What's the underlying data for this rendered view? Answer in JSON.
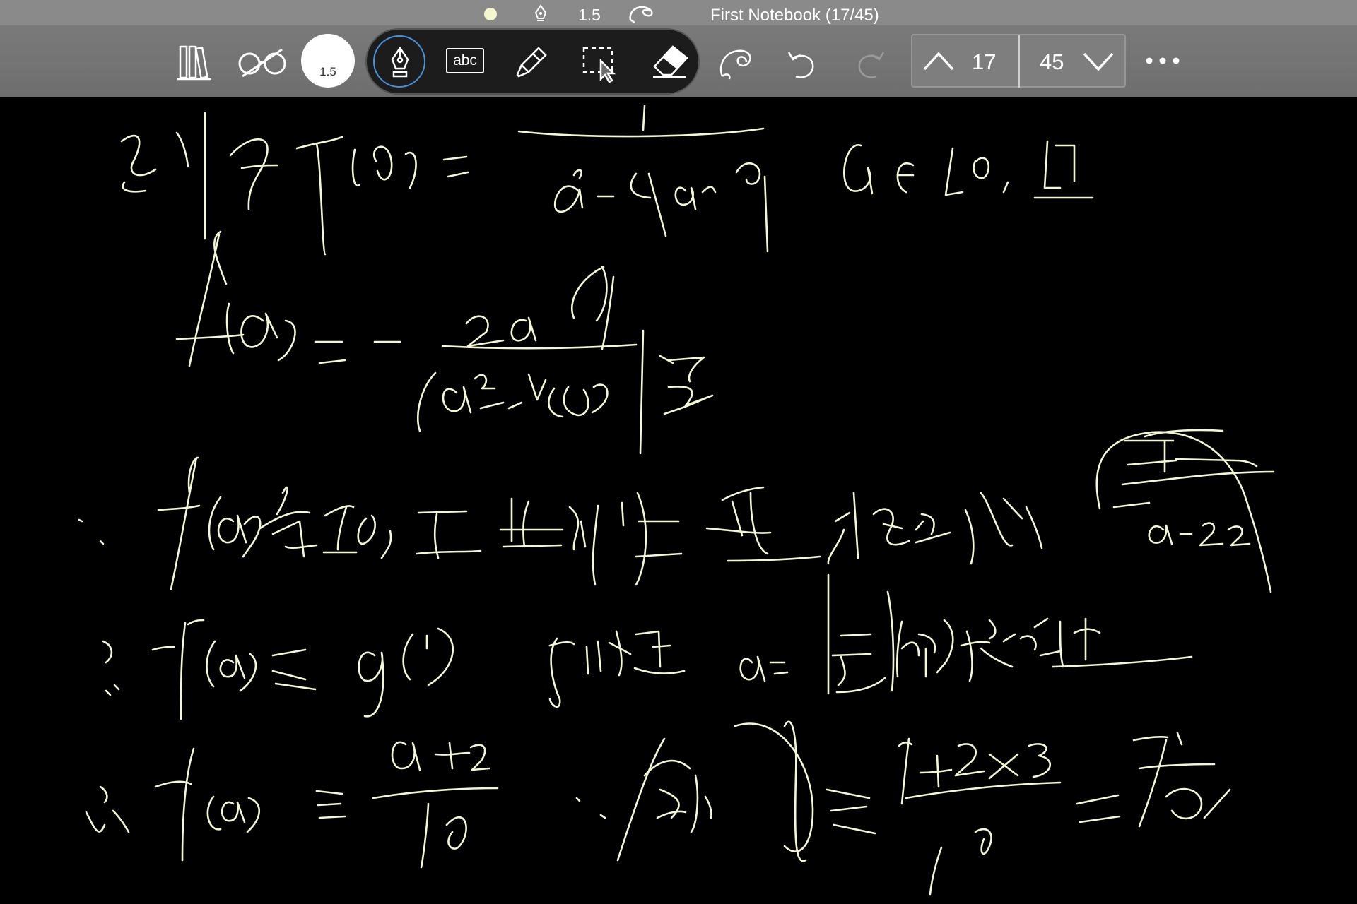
{
  "status_bar": {
    "pen_width": "1.5",
    "notebook_title": "First Notebook (17/45)"
  },
  "toolbar": {
    "pen_width_label": "1.5",
    "text_tool_label": "abc",
    "active_tool": "pen",
    "icons": [
      "library-icon",
      "read-mode-icon",
      "pen-icon",
      "text-icon",
      "highlighter-icon",
      "select-icon",
      "eraser-icon",
      "lasso-icon",
      "undo-icon",
      "redo-icon",
      "page-up-icon",
      "page-down-icon",
      "more-icon"
    ],
    "accent_color": "#4a90d9",
    "ink_color": "#f4f6d8"
  },
  "page_nav": {
    "current_page": "17",
    "total_pages": "45"
  }
}
